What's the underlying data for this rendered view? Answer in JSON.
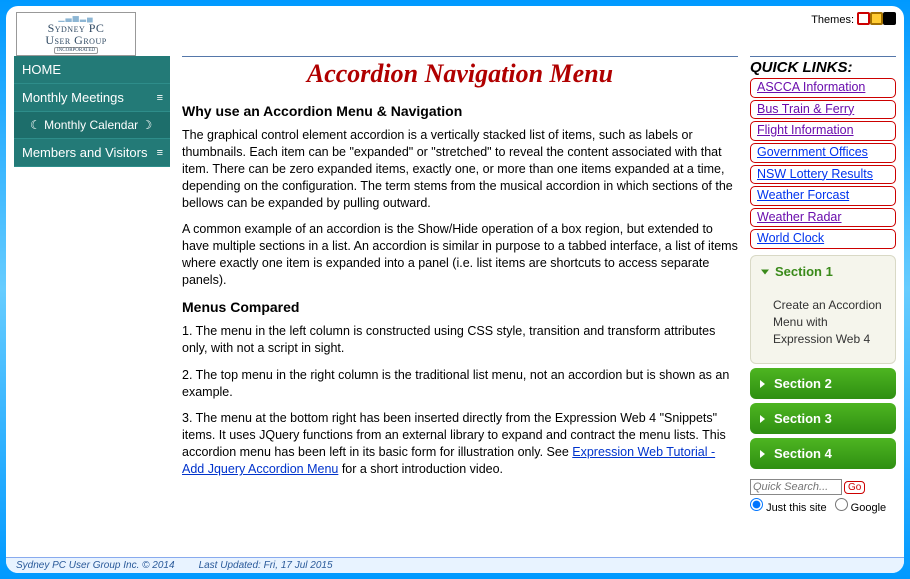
{
  "themes_label": "Themes:",
  "theme_swatches": [
    {
      "name": "theme-white",
      "bg": "#ffffff",
      "border": "#cc0000"
    },
    {
      "name": "theme-yellow",
      "bg": "#ffcc33",
      "border": "#a37000"
    },
    {
      "name": "theme-black",
      "bg": "#000000",
      "border": "#000000"
    }
  ],
  "logo": {
    "line1": "Sydney PC",
    "line2": "User Group",
    "inc": "INCORPORATED"
  },
  "leftnav": [
    {
      "label": "HOME",
      "type": "plain"
    },
    {
      "label": "Monthly Meetings",
      "type": "burger"
    },
    {
      "label": "Monthly Calendar",
      "type": "moons"
    },
    {
      "label": "Members and Visitors",
      "type": "burger"
    }
  ],
  "main": {
    "title": "Accordion Navigation Menu",
    "h2a": "Why use an Accordion Menu & Navigation",
    "p1": "The graphical control element accordion is a vertically stacked list of items, such as labels or thumbnails. Each item can be \"expanded\" or \"stretched\" to reveal the content associated with that item. There can be zero expanded items, exactly one, or more than one items expanded at a time, depending on the configuration. The term stems from the musical accordion in which sections of the bellows can be expanded by pulling outward.",
    "p2": "A common example of an accordion is the Show/Hide operation of a box region, but extended to have multiple sections in a list. An accordion is similar in purpose to a tabbed interface, a list of items where exactly one item is expanded into a panel (i.e. list items are shortcuts to access separate panels).",
    "h2b": "Menus Compared",
    "p3": "1. The menu in the left column is constructed using CSS style, transition and transform attributes only, with not a script in sight.",
    "p4": "2. The top menu in the right column is the traditional list menu, not an accordion but is shown as an example.",
    "p5a": "3. The menu at the bottom right has been inserted directly from the Expression Web 4 \"Snippets\" items. It uses JQuery functions from an external library to expand and contract the menu lists. This accordion menu has been left in its basic form for illustration only. See ",
    "p5link": "Expression Web Tutorial - Add Jquery Accordion Menu",
    "p5b": " for a short introduction video."
  },
  "quicklinks": {
    "heading": "QUICK LINKS:",
    "items": [
      {
        "label": "ASCCA Information",
        "cls": "purple"
      },
      {
        "label": "Bus Train & Ferry",
        "cls": "purple"
      },
      {
        "label": "Flight Information",
        "cls": "purple"
      },
      {
        "label": "Government Offices",
        "cls": "blue"
      },
      {
        "label": "NSW Lottery Results",
        "cls": "blue"
      },
      {
        "label": "Weather Forcast",
        "cls": "blue"
      },
      {
        "label": "Weather Radar",
        "cls": "purple"
      },
      {
        "label": "World Clock",
        "cls": "blue"
      }
    ]
  },
  "accordion": [
    {
      "label": "Section 1",
      "open": true,
      "body": "Create an Accordion Menu with Expression Web 4"
    },
    {
      "label": "Section 2",
      "open": false
    },
    {
      "label": "Section 3",
      "open": false
    },
    {
      "label": "Section 4",
      "open": false
    }
  ],
  "search": {
    "placeholder": "Quick Search...",
    "go": "Go",
    "opt1": "Just this site",
    "opt2": "Google"
  },
  "footer": {
    "copyright": "Sydney PC User Group Inc. © 2014",
    "updated": "Last Updated: Fri, 17 Jul 2015"
  }
}
